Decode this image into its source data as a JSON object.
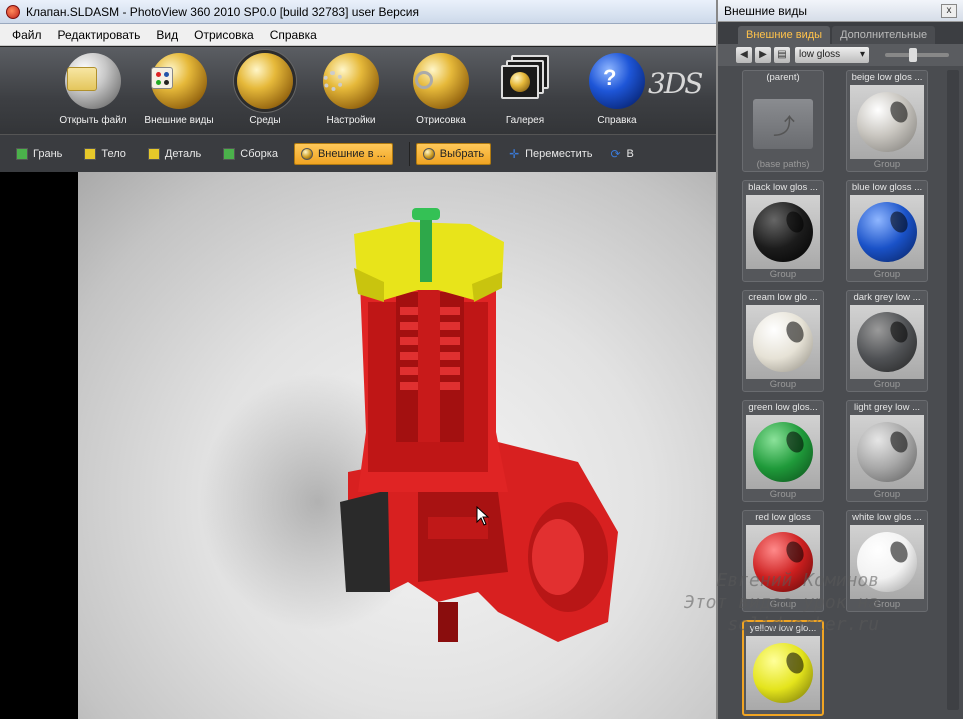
{
  "window": {
    "title": "Клапан.SLDASM - PhotoView 360 2010 SP0.0 [build 32783] user Версия"
  },
  "menu": [
    "Файл",
    "Редактировать",
    "Вид",
    "Отрисовка",
    "Справка"
  ],
  "toolbar": {
    "open_file": "Открыть файл",
    "appearances": "Внешние виды",
    "environments": "Среды",
    "settings": "Настройки",
    "render": "Отрисовка",
    "gallery": "Галерея",
    "help": "Справка",
    "brand": "3DS"
  },
  "tabs": {
    "face": "Грань",
    "body": "Тело",
    "part": "Деталь",
    "assembly": "Сборка",
    "appearances": "Внешние в ...",
    "select": "Выбрать",
    "move": "Переместить",
    "rotate": "В"
  },
  "panel": {
    "title": "Внешние виды",
    "tab_active": "Внешние виды",
    "tab_more": "Дополнительные",
    "filter": "low gloss",
    "close": "x",
    "items": [
      {
        "label": "(parent)",
        "sub": "(base paths)",
        "type": "folder"
      },
      {
        "label": "beige low glos ...",
        "sub": "Group",
        "color": "#c9c6c0"
      },
      {
        "label": "black low glos ...",
        "sub": "Group",
        "color": "#1c1c1c"
      },
      {
        "label": "blue low gloss ...",
        "sub": "Group",
        "color": "#1a52c8"
      },
      {
        "label": "cream low glo ...",
        "sub": "Group",
        "color": "#e6e2d6"
      },
      {
        "label": "dark grey low ...",
        "sub": "Group",
        "color": "#505255"
      },
      {
        "label": "green low glos...",
        "sub": "Group",
        "color": "#1f9a3a"
      },
      {
        "label": "light grey low ...",
        "sub": "Group",
        "color": "#a7a7a7"
      },
      {
        "label": "red low gloss",
        "sub": "Group",
        "color": "#cc1f1f"
      },
      {
        "label": "white low glos ...",
        "sub": "Group",
        "color": "#f2f2f2"
      },
      {
        "label": "yellow low glo...",
        "sub": "",
        "color": "#e4e41c"
      }
    ]
  },
  "watermark": [
    "Евгений Коминов",
    "Этот видео урок на",
    "solidworker.ru"
  ]
}
